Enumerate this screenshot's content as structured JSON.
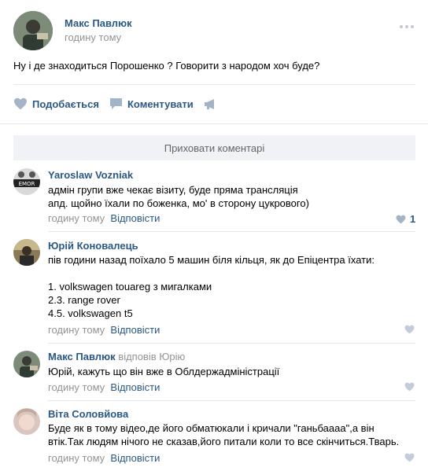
{
  "post": {
    "author": "Макс Павлюк",
    "time": "годину тому",
    "text": "Ну і де знаходиться Порошенко ? Говорити з народом хоч буде?",
    "more_icon": "more-dots-icon"
  },
  "actions": {
    "like_label": "Подобається",
    "comment_label": "Коментувати",
    "like_icon": "heart-icon",
    "comment_icon": "comment-icon",
    "share_icon": "megaphone-icon"
  },
  "hide_comments_label": "Приховати коментарі",
  "comments": [
    {
      "author": "Yaroslaw Vozniak",
      "reply_to": "",
      "text": "адмін групи вже чекає візиту, буде пряма трансляція\nапд. щойно їхали по боженка, мо' в сторону цукрового)",
      "time": "годину тому",
      "reply_label": "Відповісти",
      "likes": "1"
    },
    {
      "author": "Юрій Коновалець",
      "reply_to": "",
      "text": "пів години назад поїхало 5 машин біля кільця, як до Епіцентра їхати:\n\n1. volkswagen touareg з мигалками\n2.3. range rover\n4.5. volkswagen t5",
      "time": "годину тому",
      "reply_label": "Відповісти",
      "likes": ""
    },
    {
      "author": "Макс Павлюк",
      "reply_to": "відповів Юрію",
      "text": "Юрій, кажуть що він вже в Облдержадміністрації",
      "time": "годину тому",
      "reply_label": "Відповісти",
      "likes": ""
    },
    {
      "author": "Віта Соловйова",
      "reply_to": "",
      "text": "Буде як в тому відео,де його обматюкали і кричали \"ганьбаааа\",а він\nвтік.Так людям нічого не сказав,його питали коли то все скінчиться.Тварь.",
      "time": "годину тому",
      "reply_label": "Відповісти",
      "likes": ""
    }
  ],
  "colors": {
    "link": "#2a5885",
    "muted": "#939393",
    "divider": "#e7e8ec",
    "hide_bar_bg": "#f0f2f5",
    "icon": "#a3b4c7"
  }
}
